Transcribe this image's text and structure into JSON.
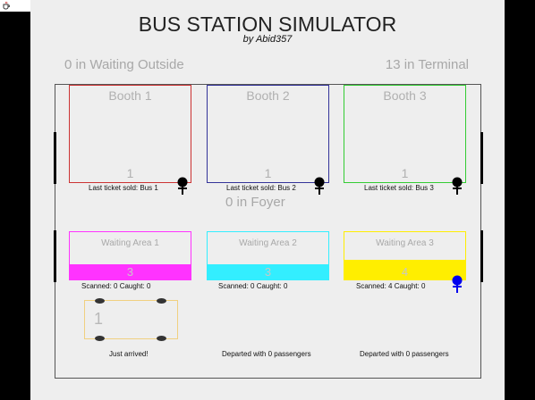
{
  "app": {
    "title": "BUS STATION SIMULATOR",
    "subtitle": "by Abid357"
  },
  "status": {
    "waiting_outside": "0 in Waiting Outside",
    "terminal": "13 in Terminal",
    "foyer": "0 in Foyer"
  },
  "booths": [
    {
      "name": "Booth 1",
      "count": "1",
      "last_sold": "Last ticket sold: Bus 1",
      "color": "#cc3333"
    },
    {
      "name": "Booth 2",
      "count": "1",
      "last_sold": "Last ticket sold: Bus 2",
      "color": "#333399"
    },
    {
      "name": "Booth 3",
      "count": "1",
      "last_sold": "Last ticket sold: Bus 3",
      "color": "#33cc33"
    }
  ],
  "waiting_areas": [
    {
      "name": "Waiting Area 1",
      "count": "3",
      "stats": "Scanned: 0   Caught: 0",
      "color": "#ff33ff"
    },
    {
      "name": "Waiting Area 2",
      "count": "3",
      "stats": "Scanned: 0   Caught: 0",
      "color": "#33eeff"
    },
    {
      "name": "Waiting Area 3",
      "count": "4",
      "stats": "Scanned: 4   Caught: 0",
      "color": "#ffee00"
    }
  ],
  "buses": [
    {
      "number": "1",
      "status": "Just arrived!"
    },
    {
      "status": "Departed with 0 passengers"
    },
    {
      "status": "Departed with 0 passengers"
    }
  ],
  "icons": {
    "app": "java-cup-icon",
    "person": "person-icon"
  }
}
